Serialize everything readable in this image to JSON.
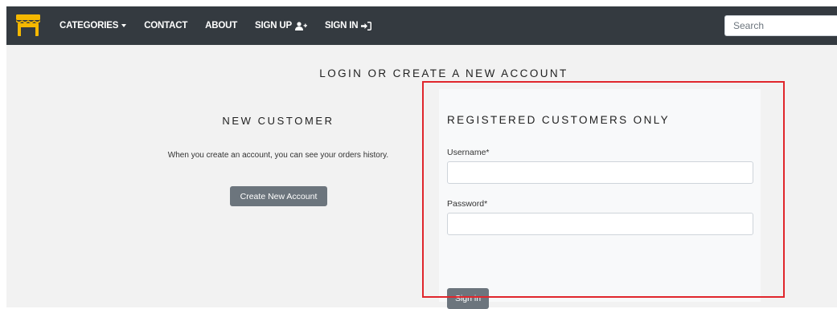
{
  "brand": {
    "icon": "storefront-icon",
    "color": "#f5b800"
  },
  "nav": {
    "categories": "CATEGORIES",
    "contact": "CONTACT",
    "about": "ABOUT",
    "signup": "SIGN UP",
    "signin": "SIGN IN"
  },
  "search": {
    "placeholder": "Search"
  },
  "page": {
    "title": "LOGIN OR CREATE A NEW ACCOUNT"
  },
  "new_customer": {
    "heading": "NEW CUSTOMER",
    "description": "When you create an account, you can see your orders history.",
    "button": "Create New Account"
  },
  "login": {
    "heading": "REGISTERED CUSTOMERS ONLY",
    "username_label": "Username*",
    "username_value": "",
    "password_label": "Password*",
    "password_value": "",
    "button": "Sign in"
  },
  "colors": {
    "navbar": "#343a40",
    "highlight": "#e0262c",
    "button": "#6c757d"
  }
}
